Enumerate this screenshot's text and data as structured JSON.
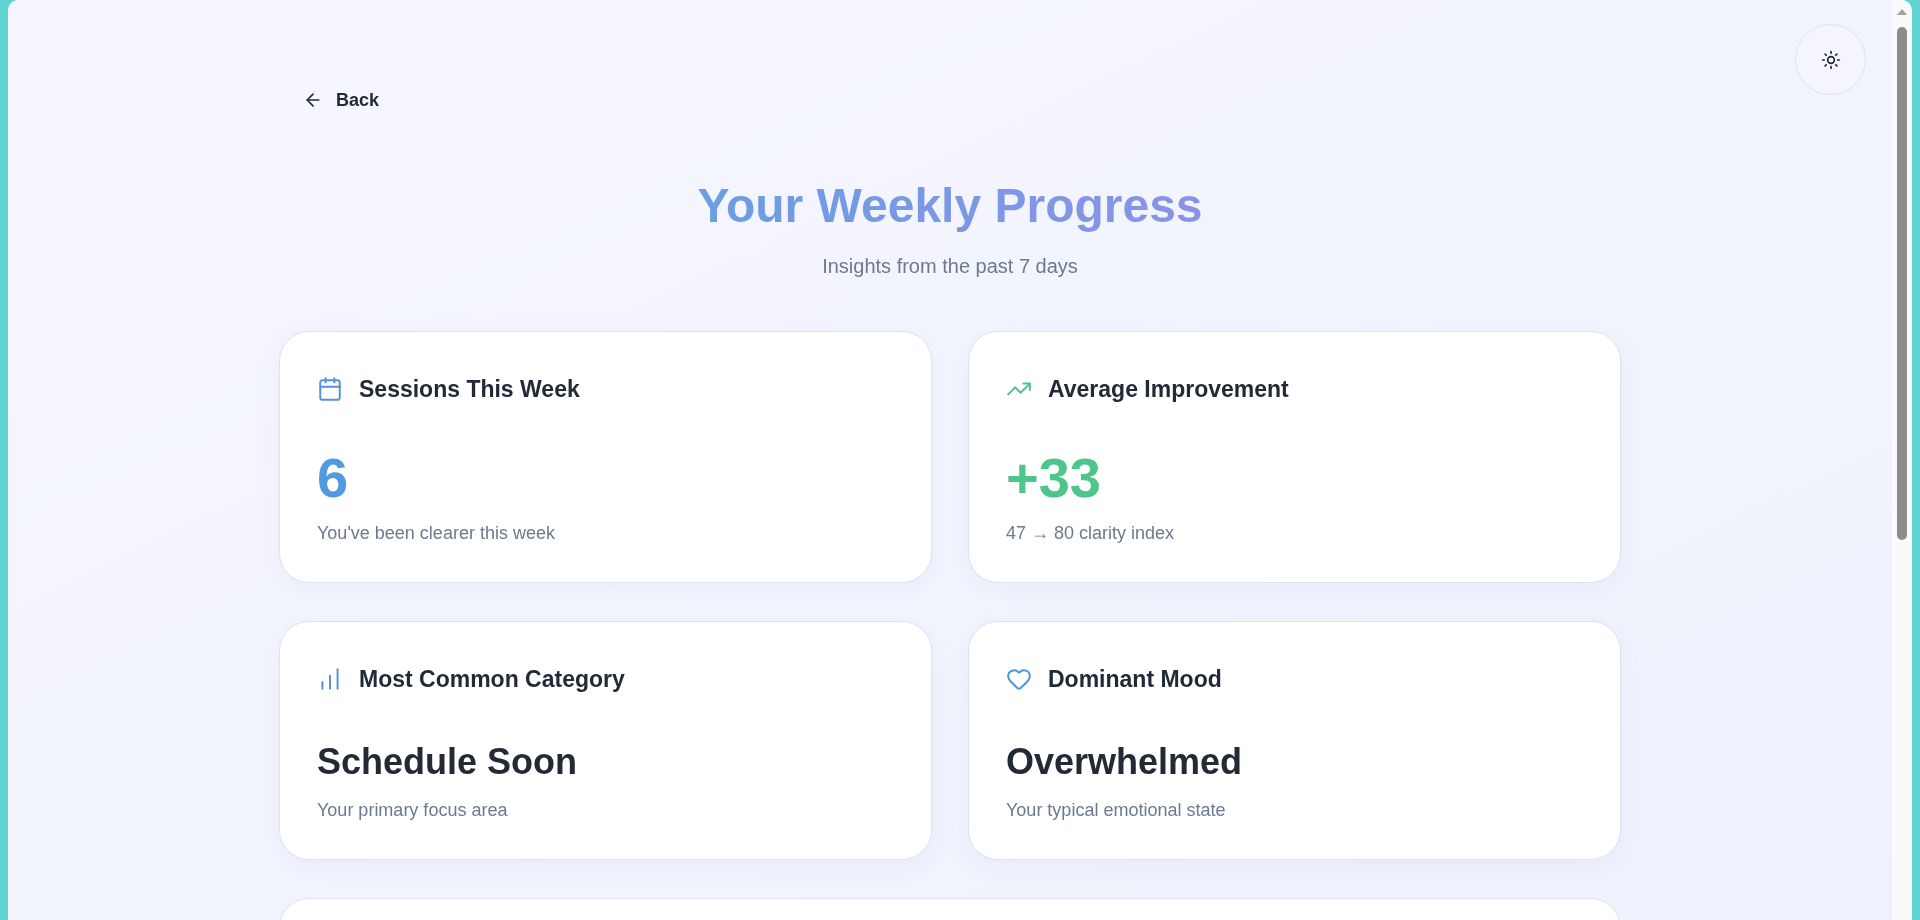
{
  "back_button": {
    "label": "Back"
  },
  "header": {
    "title": "Your Weekly Progress",
    "subtitle": "Insights from the past 7 days"
  },
  "cards": [
    {
      "kind": "sessions",
      "title": "Sessions This Week",
      "value": "6",
      "caption": "You've been clearer this week"
    },
    {
      "kind": "improvement",
      "title": "Average Improvement",
      "value": "+33",
      "caption": "47 → 80 clarity index"
    },
    {
      "kind": "category",
      "title": "Most Common Category",
      "value": "Schedule Soon",
      "caption": "Your primary focus area"
    },
    {
      "kind": "mood",
      "title": "Dominant Mood",
      "value": "Overwhelmed",
      "caption": "Your typical emotional state"
    }
  ]
}
